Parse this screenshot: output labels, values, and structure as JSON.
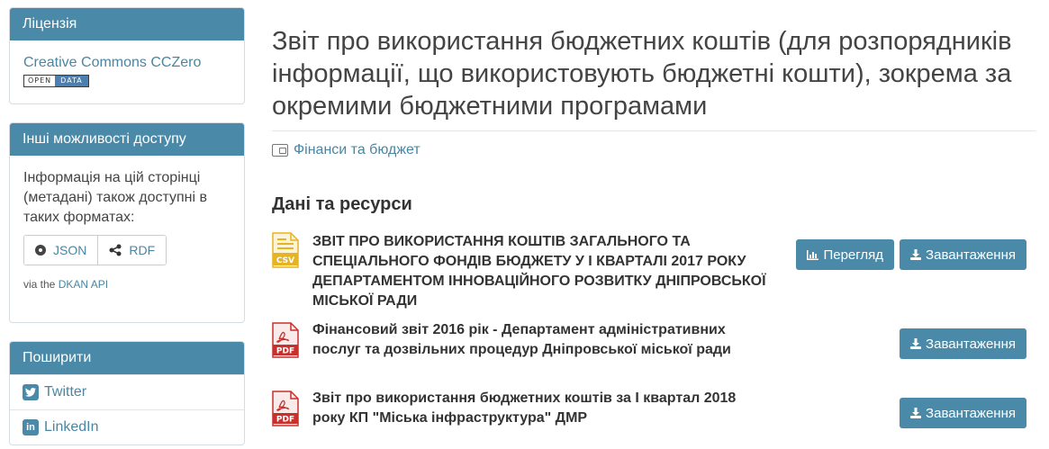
{
  "sidebar": {
    "license": {
      "heading": "Ліцензія",
      "link": "Creative Commons CCZero",
      "badge_left": "OPEN",
      "badge_right": "DATA"
    },
    "access": {
      "heading": "Інші можливості доступу",
      "text": "Інформація на цій сторінці (метадані) також доступні в таких форматах:",
      "formats": [
        "JSON",
        "RDF"
      ],
      "via_prefix": "via the",
      "via_link": "DKAN API"
    },
    "share": {
      "heading": "Поширити",
      "items": [
        "Twitter",
        "LinkedIn"
      ]
    }
  },
  "main": {
    "title": "Звіт про використання бюджетних коштів (для розпорядників інформації, що використовують бюджетні кошти), зокрема за окремими бюджетними програмами",
    "topic": "Фінанси та бюджет",
    "section_title": "Дані та ресурси",
    "resources": [
      {
        "format": "CSV",
        "title": "ЗВІТ ПРО ВИКОРИСТАННЯ КОШТІВ ЗАГАЛЬНОГО ТА СПЕЦІАЛЬНОГО ФОНДІВ БЮДЖЕТУ У І КВАРТАЛІ 2017 РОКУ ДЕПАРТАМЕНТОМ ІННОВАЦІЙНОГО РОЗВИТКУ ДНІПРОВСЬКОЇ МІСЬКОЇ РАДИ",
        "preview_label": "Перегляд",
        "download_label": "Завантаження"
      },
      {
        "format": "PDF",
        "title": "Фінансовий звіт 2016 рік - Департамент адміністративних послуг та дозвільних процедур Дніпровської міської ради",
        "download_label": "Завантаження"
      },
      {
        "format": "PDF",
        "title": "Звіт про використання бюджетних коштів за І квартал 2018 року КП \"Міська інфраструктура\" ДМР",
        "download_label": "Завантаження"
      }
    ]
  },
  "colors": {
    "accent": "#4a8aa8",
    "link": "#4a86a2",
    "csv_icon": "#e6b422",
    "pdf_icon": "#c9302c"
  },
  "icons": {
    "topic": "wallet-icon",
    "json": "json-icon",
    "rdf": "share-nodes-icon",
    "twitter": "twitter-icon",
    "linkedin": "linkedin-icon",
    "preview": "bar-chart-icon",
    "download": "download-icon"
  }
}
